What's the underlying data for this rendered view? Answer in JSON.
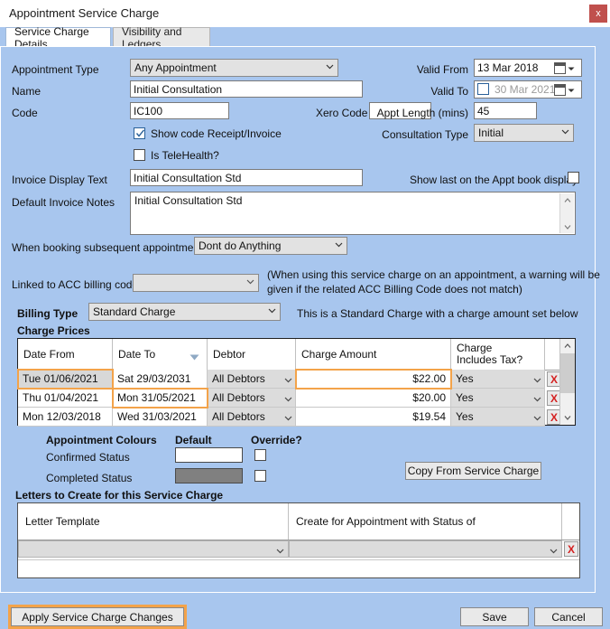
{
  "window": {
    "title": "Appointment Service Charge",
    "close_label": "x"
  },
  "tabs": [
    {
      "label": "Service Charge Details",
      "active": true
    },
    {
      "label": "Visibility and Ledgers",
      "active": false
    }
  ],
  "form": {
    "appointment_type_label": "Appointment Type",
    "appointment_type_value": "Any Appointment",
    "name_label": "Name",
    "name_value": "Initial Consultation",
    "code_label": "Code",
    "code_value": "IC100",
    "xero_code_label": "Xero Code",
    "xero_code_value": "",
    "show_code_receipt_label": "Show code Receipt/Invoice",
    "show_code_receipt_checked": true,
    "is_telehealth_label": "Is TeleHealth?",
    "is_telehealth_checked": false,
    "valid_from_label": "Valid From",
    "valid_from_value": "13 Mar 2018",
    "valid_to_label": "Valid To",
    "valid_to_value": "30 Mar 2021",
    "valid_to_enabled": false,
    "appt_length_label": "Appt Length (mins)",
    "appt_length_value": "45",
    "consultation_type_label": "Consultation Type",
    "consultation_type_value": "Initial",
    "invoice_display_text_label": "Invoice Display Text",
    "invoice_display_text_value": "Initial Consultation Std",
    "show_last_label": "Show last on the Appt book display",
    "show_last_checked": false,
    "default_invoice_notes_label": "Default Invoice Notes",
    "default_invoice_notes_value": "Initial Consultation Std",
    "subsequent_label": "When booking subsequent appointments",
    "subsequent_value": "Dont do Anything",
    "acc_billing_label": "Linked to ACC billing code",
    "acc_billing_value": "",
    "acc_note_line1": "(When using this service charge on an appointment, a warning will be",
    "acc_note_line2": "given if the related ACC Billing Code does not match)",
    "billing_type_label": "Billing Type",
    "billing_type_value": "Standard Charge",
    "billing_type_note": "This is a Standard Charge with a charge amount set below"
  },
  "charge_prices": {
    "section_label": "Charge Prices",
    "columns": [
      "Date From",
      "Date To",
      "Debtor",
      "Charge Amount",
      "Charge\nIncludes Tax?"
    ],
    "columns_display": [
      {
        "line1": "Date From",
        "line2": ""
      },
      {
        "line1": "Date To",
        "line2": "",
        "sort": "desc"
      },
      {
        "line1": "Debtor",
        "line2": ""
      },
      {
        "line1": "Charge Amount",
        "line2": ""
      },
      {
        "line1": "Charge",
        "line2": "Includes Tax?"
      }
    ],
    "rows": [
      {
        "date_from": "Tue 01/06/2021",
        "date_to": "Sat 29/03/2031",
        "debtor": "All Debtors",
        "amount": "$22.00",
        "includes_tax": "Yes",
        "delete_label": "X",
        "highlight": "amount",
        "selected": true
      },
      {
        "date_from": "Thu 01/04/2021",
        "date_to": "Mon 31/05/2021",
        "debtor": "All Debtors",
        "amount": "$20.00",
        "includes_tax": "Yes",
        "delete_label": "X",
        "highlight": "date_to",
        "selected": false
      },
      {
        "date_from": "Mon 12/03/2018",
        "date_to": "Wed 31/03/2021",
        "debtor": "All Debtors",
        "amount": "$19.54",
        "includes_tax": "Yes",
        "delete_label": "X",
        "highlight": "",
        "selected": false
      }
    ]
  },
  "appointment_colours": {
    "heading": "Appointment Colours",
    "default_heading": "Default",
    "override_heading": "Override?",
    "rows": [
      {
        "label": "Confirmed Status",
        "colour": "#ffffff",
        "override": false
      },
      {
        "label": "Completed Status",
        "colour": "#808080",
        "override": false
      }
    ],
    "copy_button": "Copy From Service Charge"
  },
  "letters": {
    "section_label": "Letters to Create for this Service Charge",
    "columns": [
      "Letter Template",
      "Create for Appointment with Status of"
    ],
    "rows": [
      {
        "template": "",
        "status": "",
        "delete_label": "X"
      }
    ]
  },
  "footer": {
    "apply_label": "Apply Service Charge Changes",
    "save_label": "Save",
    "cancel_label": "Cancel"
  },
  "colors": {
    "window_bg": "#a8c6ee",
    "highlight": "#f3a34a",
    "close_red": "#c0504d",
    "delete_red": "#d42020"
  }
}
